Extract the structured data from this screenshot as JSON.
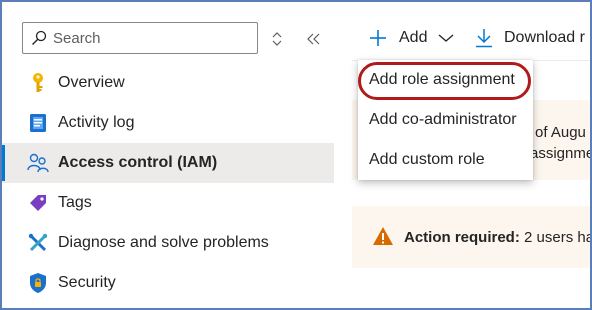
{
  "search": {
    "placeholder": "Search"
  },
  "sidebar": {
    "items": [
      {
        "label": "Overview",
        "icon": "key-icon"
      },
      {
        "label": "Activity log",
        "icon": "activity-log-icon"
      },
      {
        "label": "Access control (IAM)",
        "icon": "people-icon",
        "active": true
      },
      {
        "label": "Tags",
        "icon": "tag-icon"
      },
      {
        "label": "Diagnose and solve problems",
        "icon": "wrench-icon"
      },
      {
        "label": "Security",
        "icon": "shield-icon"
      }
    ]
  },
  "toolbar": {
    "add_label": "Add",
    "download_label": "Download r"
  },
  "menu": {
    "items": [
      {
        "label": "Add role assignment"
      },
      {
        "label": "Add co-administrator"
      },
      {
        "label": "Add custom role"
      }
    ]
  },
  "info_card": {
    "line1": "of Augu",
    "line2": "assignme"
  },
  "warning": {
    "bold": "Action required:",
    "text": " 2 users hav"
  },
  "colors": {
    "accent": "#0078d4",
    "highlight": "#b01a1a",
    "warning": "#d66b00",
    "card_bg": "#fdf6ef"
  }
}
